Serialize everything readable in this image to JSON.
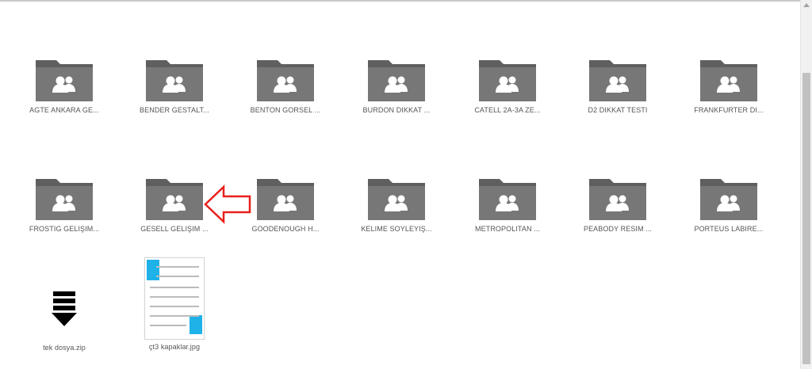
{
  "folders": [
    {
      "label": "AGTE ANKARA GE..."
    },
    {
      "label": "BENDER GESTALT..."
    },
    {
      "label": "BENTON GORSEL ..."
    },
    {
      "label": "BURDON DIKKAT ..."
    },
    {
      "label": "CATELL 2A-3A ZE..."
    },
    {
      "label": "D2 DIKKAT TESTI"
    },
    {
      "label": "FRANKFURTER DI..."
    },
    {
      "label": "FROSTIG GELIŞIM..."
    },
    {
      "label": "GESELL GELIŞIM ..."
    },
    {
      "label": "GOODENOUGH H..."
    },
    {
      "label": "KELIME SOYLEYIŞ..."
    },
    {
      "label": "METROPOLITAN ..."
    },
    {
      "label": "PEABODY RESIM ..."
    },
    {
      "label": "PORTEUS LABIRE..."
    }
  ],
  "files": [
    {
      "label": "tek dosya.zip",
      "icon": "zip-download-icon"
    },
    {
      "label": "çt3 kapaklar.jpg",
      "icon": "image-thumbnail"
    }
  ],
  "colors": {
    "folder": "#777777",
    "folder_tab": "#5f5f5f",
    "people_icon": "#ffffff",
    "annotation_arrow": "#e8201c",
    "thumbnail_accent": "#1eb2e9"
  }
}
